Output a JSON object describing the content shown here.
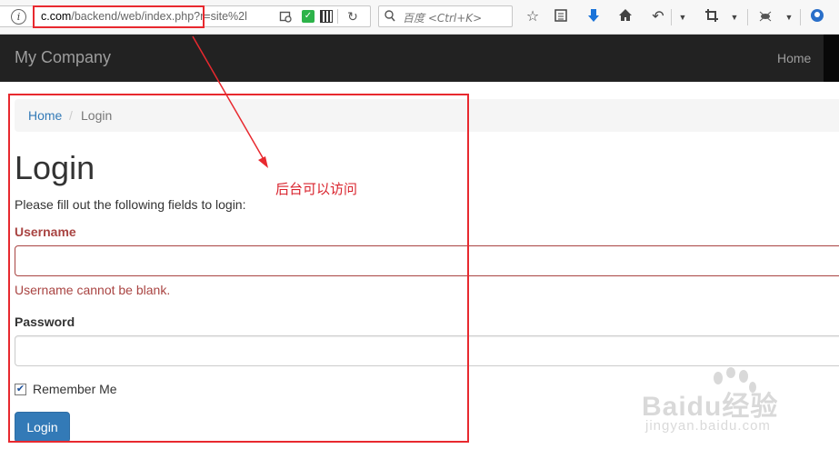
{
  "browser": {
    "url_host": "c.com",
    "url_rest": "/backend/web/index.php?r=site%2l",
    "search_placeholder": "百度 <Ctrl+K>"
  },
  "navbar": {
    "brand": "My Company",
    "home_label": "Home"
  },
  "breadcrumb": {
    "home": "Home",
    "separator": "/",
    "current": "Login"
  },
  "page": {
    "title": "Login",
    "intro": "Please fill out the following fields to login:"
  },
  "form": {
    "username_label": "Username",
    "username_value": "",
    "username_error": "Username cannot be blank.",
    "password_label": "Password",
    "password_value": "",
    "remember_label": "Remember Me",
    "remember_checked": true,
    "submit_label": "Login"
  },
  "annotation": {
    "note": "后台可以访问"
  },
  "watermark": {
    "brand": "Baidu经验",
    "domain": "jingyan.baidu.com"
  },
  "colors": {
    "error": "#a94442",
    "primary": "#337ab7",
    "navbar": "#222222",
    "annotation": "#e8292f"
  },
  "icons": [
    "info-icon",
    "shield-icon",
    "qr-icon",
    "reload-icon",
    "search-icon",
    "star-icon",
    "reading-list-icon",
    "download-icon",
    "home-icon",
    "back-icon",
    "crop-icon",
    "extension-icon",
    "account-icon"
  ]
}
